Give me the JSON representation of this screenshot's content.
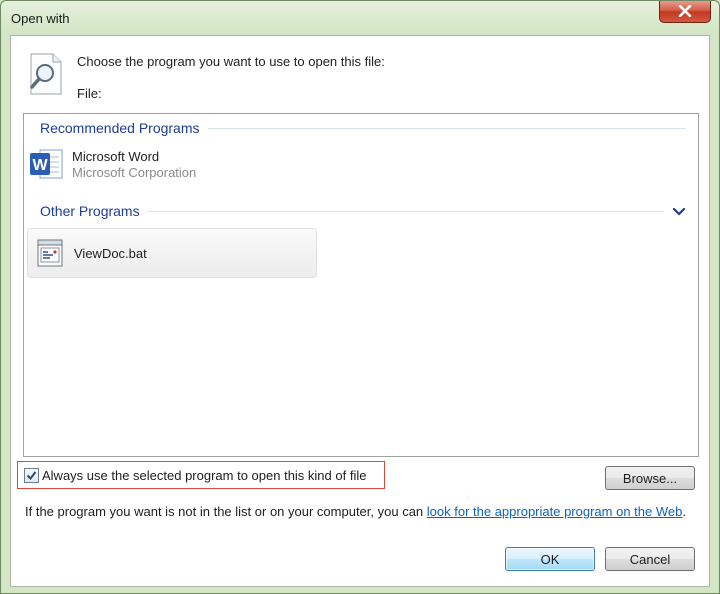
{
  "window": {
    "title": "Open with"
  },
  "header": {
    "prompt": "Choose the program you want to use to open this file:",
    "file_label": "File:"
  },
  "groups": {
    "recommended": {
      "title": "Recommended Programs",
      "items": [
        {
          "name": "Microsoft Word",
          "publisher": "Microsoft Corporation",
          "icon": "word-icon"
        }
      ]
    },
    "other": {
      "title": "Other Programs",
      "items": [
        {
          "name": "ViewDoc.bat",
          "icon": "batch-file-icon"
        }
      ]
    }
  },
  "checkbox": {
    "label": "Always use the selected program to open this kind of file",
    "checked": true
  },
  "buttons": {
    "browse": "Browse...",
    "ok": "OK",
    "cancel": "Cancel"
  },
  "info": {
    "text": "If the program you want is not in the list or on your computer, you can ",
    "link": "look for the appropriate program on the Web",
    "suffix": "."
  },
  "colors": {
    "link": "#0b62c4",
    "group_title": "#1f3d94",
    "highlight_border": "#e0463a",
    "close_button": "#c2391f"
  }
}
